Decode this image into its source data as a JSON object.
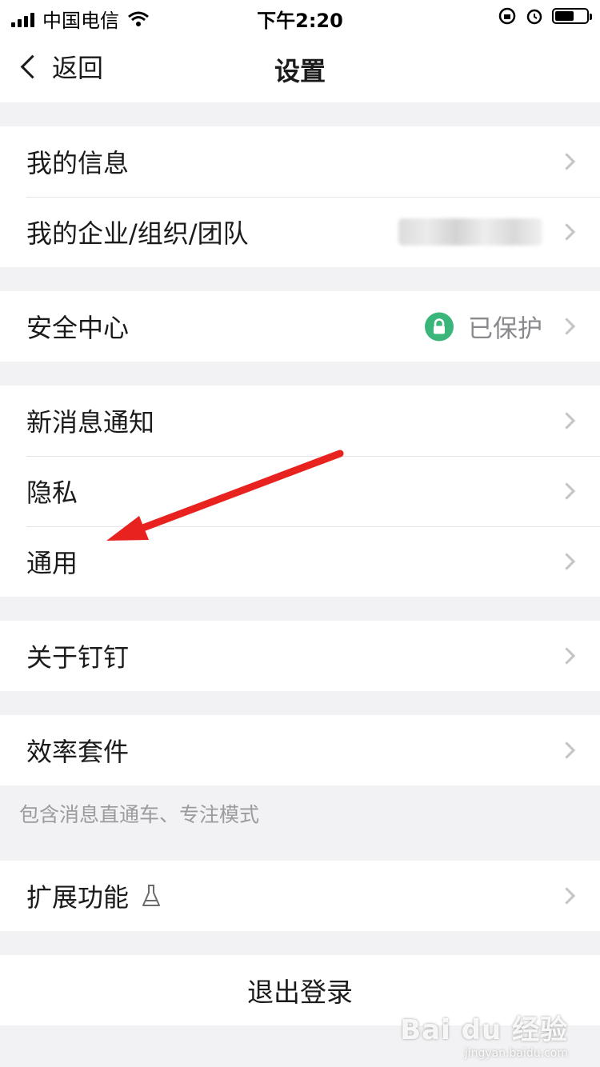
{
  "status_bar": {
    "carrier": "中国电信",
    "time": "下午2:20"
  },
  "nav": {
    "back_label": "返回",
    "title": "设置"
  },
  "groups": {
    "profile": [
      "我的信息",
      "我的企业/组织/团队"
    ],
    "security": {
      "label": "安全中心",
      "status": "已保护"
    },
    "preferences": [
      "新消息通知",
      "隐私",
      "通用"
    ],
    "about": "关于钉钉",
    "efficiency": "效率套件",
    "efficiency_note": "包含消息直通车、专注模式",
    "extensions": "扩展功能"
  },
  "logout_label": "退出登录",
  "watermark": {
    "brand": "Bai du 经验",
    "url": "jingyan.baidu.com"
  },
  "colors": {
    "accent_green": "#3ab67b",
    "annotation_red": "#e8231f"
  },
  "icons": [
    "signal-icon",
    "wifi-icon",
    "rotation-lock-icon",
    "alarm-icon",
    "battery-icon",
    "lock-icon",
    "flask-icon",
    "chevron-right-icon"
  ]
}
